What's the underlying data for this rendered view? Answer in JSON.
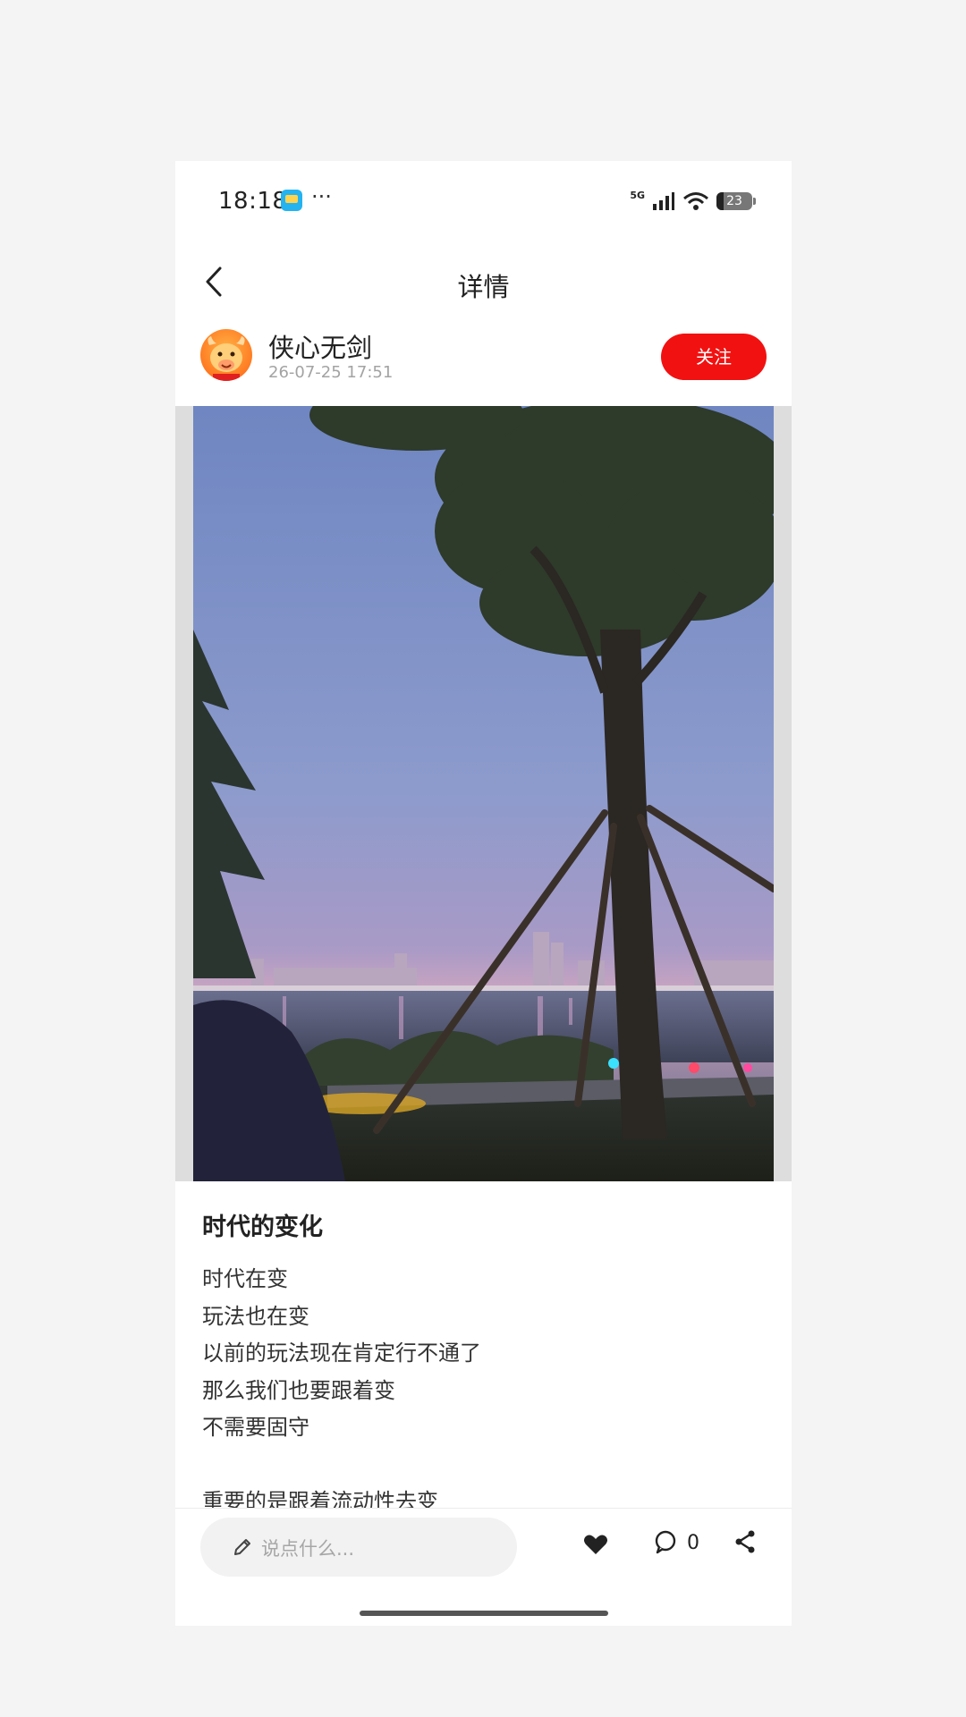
{
  "status_bar": {
    "time": "18:18",
    "dots": "···",
    "network": "5G",
    "battery": "23"
  },
  "nav": {
    "title": "详情"
  },
  "author": {
    "name": "侠心无剑",
    "time": "26-07-25 17:51",
    "follow_label": "关注"
  },
  "post": {
    "title": "时代的变化",
    "lines": [
      "时代在变",
      "玩法也在变",
      "以前的玩法现在肯定行不通了",
      "那么我们也要跟着变",
      "不需要固守",
      "",
      "重要的是跟着流动性去变"
    ]
  },
  "bottom_bar": {
    "comment_placeholder": "说点什么...",
    "comment_count": "0"
  },
  "colors": {
    "accent": "#f21111",
    "background": "#f4f4f4"
  }
}
